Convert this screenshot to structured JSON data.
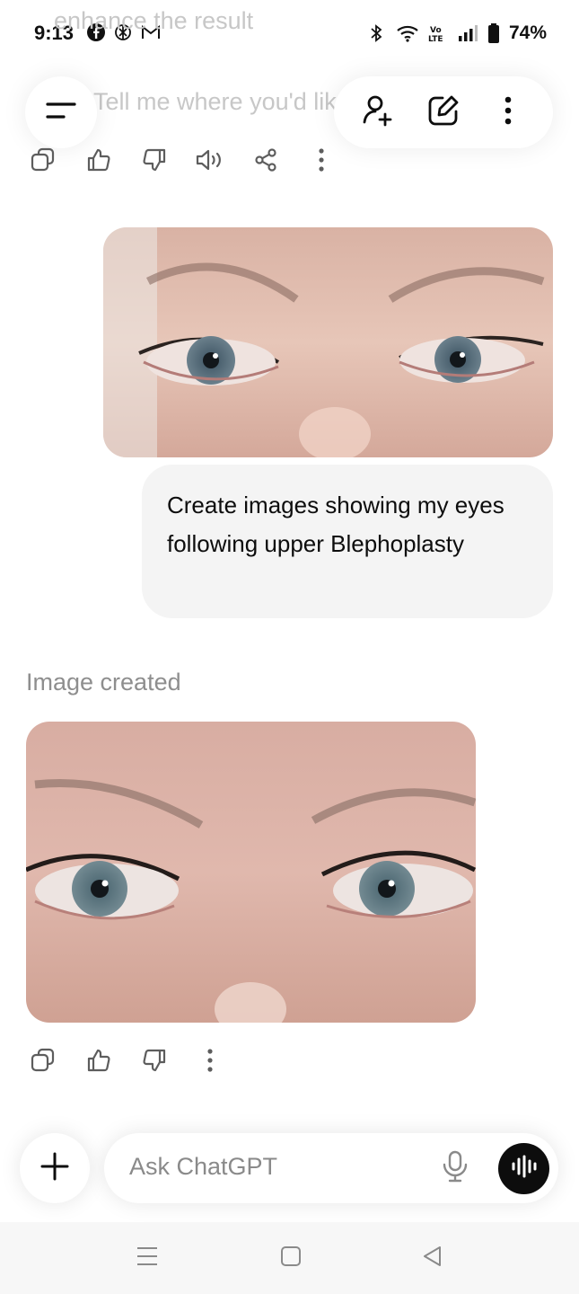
{
  "status_bar": {
    "time": "9:13",
    "battery": "74%",
    "left_icons": [
      "facebook-icon",
      "chatgpt-icon",
      "gmail-icon"
    ],
    "right_icons": [
      "bluetooth-icon",
      "wifi-icon",
      "volte-icon",
      "signal-icon",
      "battery-icon"
    ]
  },
  "background_text": {
    "line1": "enhance the result",
    "line2": "Tell me where you'd lik"
  },
  "header": {
    "menu_icon": "menu-icon",
    "actions": [
      "add-person-icon",
      "new-chat-icon",
      "more-vertical-icon"
    ]
  },
  "message_actions_top": [
    "copy-icon",
    "thumbs-up-icon",
    "thumbs-down-icon",
    "read-aloud-icon",
    "share-icon",
    "more-vertical-icon"
  ],
  "user_message": {
    "text": "Create images showing my eyes following upper Blephoplasty"
  },
  "assistant": {
    "image_created_label": "Image created"
  },
  "message_actions_bottom": [
    "copy-icon",
    "thumbs-up-icon",
    "thumbs-down-icon",
    "more-vertical-icon"
  ],
  "composer": {
    "placeholder": "Ask ChatGPT",
    "value": ""
  },
  "colors": {
    "bubble": "#f4f4f4",
    "voice_button": "#0d0d0d",
    "muted_text": "#8e8e8e"
  }
}
